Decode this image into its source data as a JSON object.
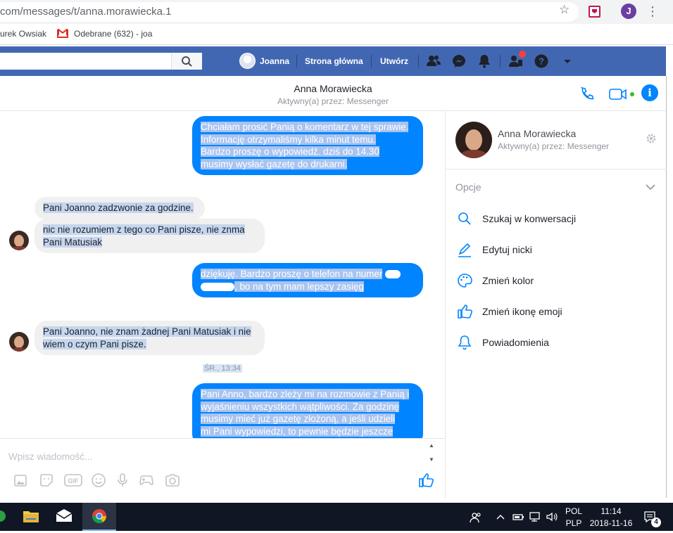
{
  "browser": {
    "url": "com/messages/t/anna.morawiecka.1",
    "profile_initial": "J",
    "bookmarks": [
      {
        "label": "urek Owsiak"
      },
      {
        "label": "Odebrane (632) - joa"
      }
    ]
  },
  "facebook_bar": {
    "user_name": "Joanna",
    "home_label": "Strona główna",
    "create_label": "Utwórz"
  },
  "conversation": {
    "name": "Anna Morawiecka",
    "status": "Aktywny(a) przez: Messenger",
    "messages": [
      {
        "direction": "out",
        "lines": [
          "Chciałam prosić Panią o komentarz w tej sprawie.",
          "Informację otrzymaliśmy kilka minut temu.",
          "Bardzo proszę o wypowiedź. dziś do 14.30",
          "musimy wysłać gazetę do drukarni."
        ]
      },
      {
        "direction": "in",
        "lines": [
          "Pani Joanno zadzwonie za godzine."
        ]
      },
      {
        "direction": "in",
        "lines": [
          "nic nie rozumiem z tego co Pani pisze, nie znma",
          "Pani Matusiak"
        ]
      },
      {
        "direction": "out",
        "lines": [
          "dziękuję. Bardzo proszę o telefon na numer",
          ", bo na tym mam lepszy zasięg"
        ]
      },
      {
        "direction": "in",
        "lines": [
          "Pani Joanno, nie znam żadnej Pani Matusiak i nie",
          "wiem o czym Pani pisze."
        ]
      },
      {
        "direction": "out",
        "lines": [
          "Pani Anno, bardzo zleży mi na rozmowie z Panią i",
          "wyjaśnieniu wszystkich wątpliwości. Za godzinę",
          "musimy mieć już gazetę złożoną, a jeśli udzieli",
          "mi Pani wypowiedzi, to pewnie będzie jeszcze"
        ]
      }
    ],
    "timestamp": "ŚR., 13:34"
  },
  "composer": {
    "placeholder": "Wpisz wiadomość...",
    "gif_label": "GIF"
  },
  "right_panel": {
    "name": "Anna Morawiecka",
    "status": "Aktywny(a) przez: Messenger",
    "options_label": "Opcje",
    "items": [
      {
        "label": "Szukaj w konwersacji",
        "icon": "search-icon"
      },
      {
        "label": "Edytuj nicki",
        "icon": "pencil-icon"
      },
      {
        "label": "Zmień kolor",
        "icon": "palette-icon"
      },
      {
        "label": "Zmień ikonę emoji",
        "icon": "thumbs-up-icon"
      },
      {
        "label": "Powiadomienia",
        "icon": "bell-icon"
      }
    ]
  },
  "taskbar": {
    "language": "POL",
    "layout": "PLP",
    "time": "11:14",
    "date": "2018-11-16",
    "notification_count": "4"
  },
  "colors": {
    "facebook_blue": "#4267b2",
    "messenger_blue": "#0084ff",
    "taskbar": "#101623"
  }
}
